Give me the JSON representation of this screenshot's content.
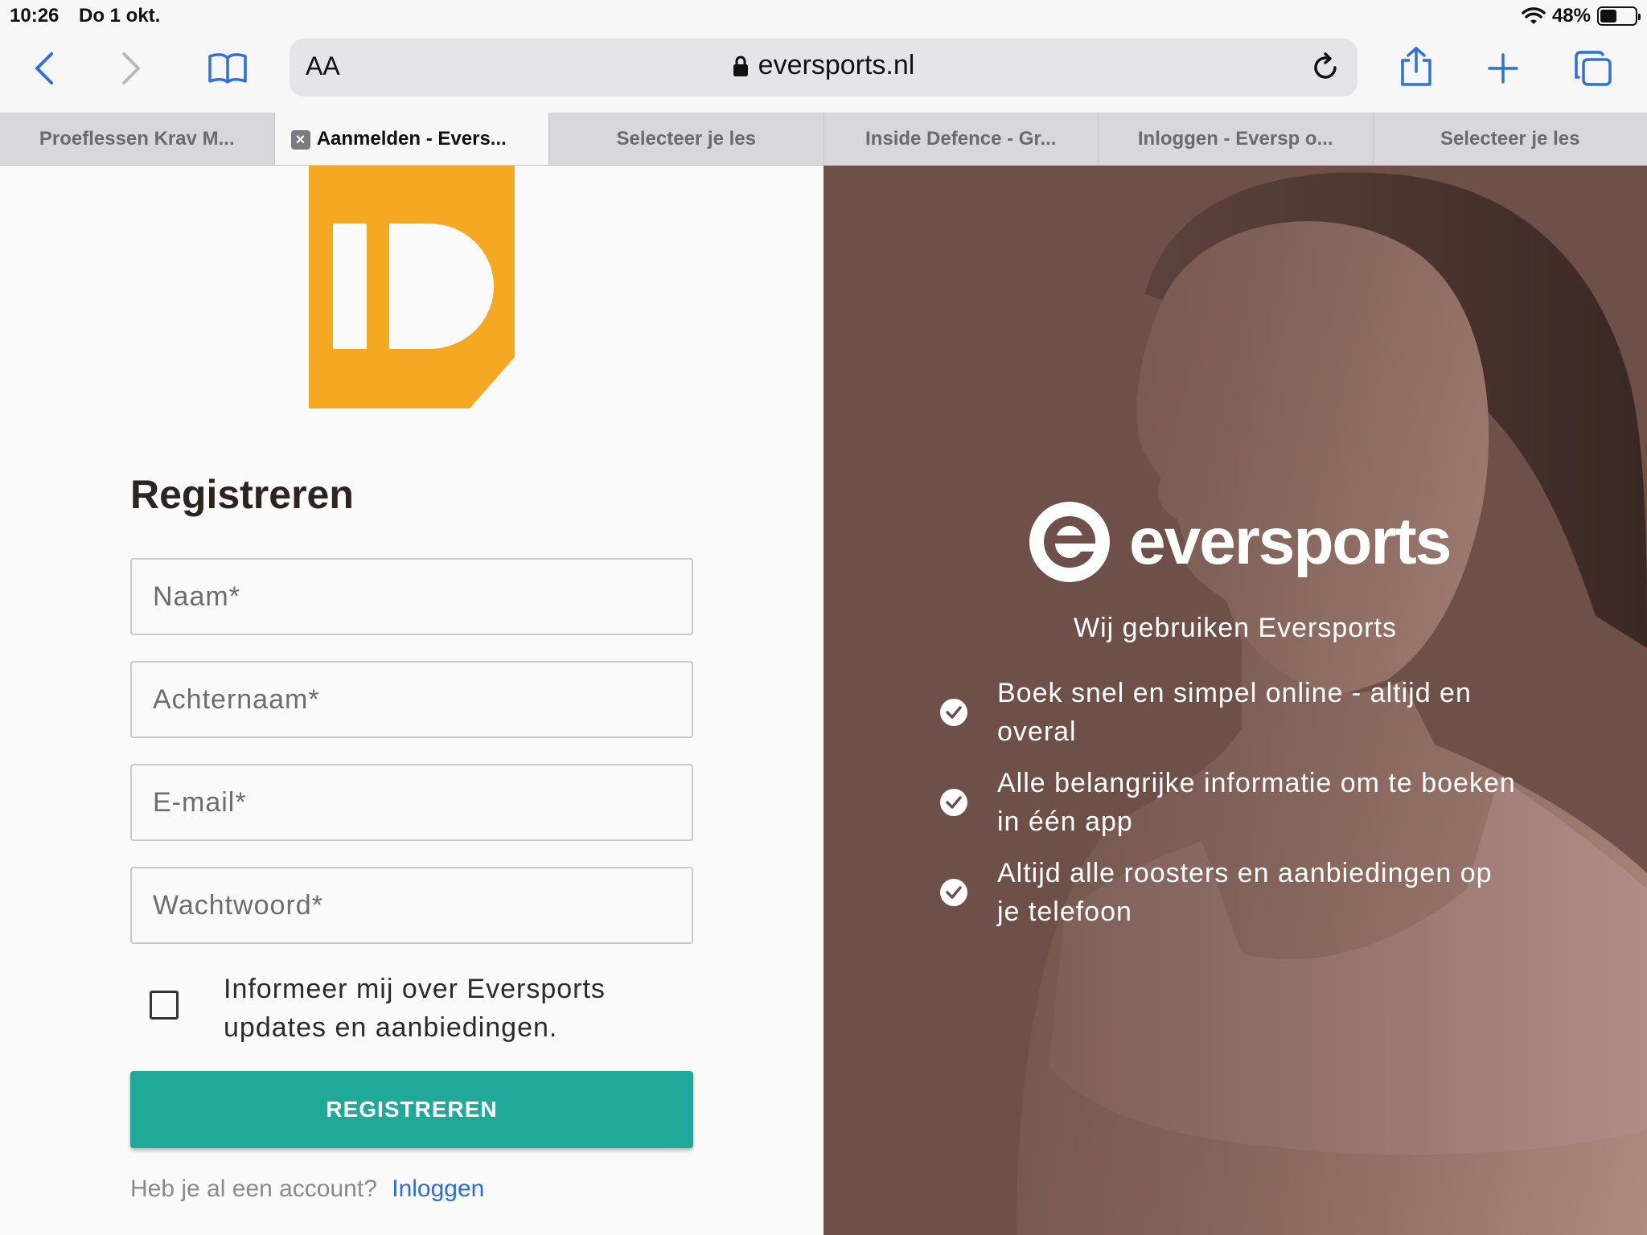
{
  "status": {
    "time": "10:26",
    "date": "Do 1 okt.",
    "battery": "48%",
    "battery_level": 0.48
  },
  "browser": {
    "text_size_label": "AA",
    "url": "eversports.nl",
    "tabs": [
      {
        "label": "Proeflessen Krav M..."
      },
      {
        "label": "Aanmelden - Evers..."
      },
      {
        "label": "Selecteer je les"
      },
      {
        "label": "Inside Defence - Gr..."
      },
      {
        "label": "Inloggen - Eversp o..."
      },
      {
        "label": "Selecteer je les"
      }
    ]
  },
  "form": {
    "title": "Registreren",
    "name_placeholder": "Naam*",
    "lastname_placeholder": "Achternaam*",
    "email_placeholder": "E-mail*",
    "password_placeholder": "Wachtwoord*",
    "consent_text": "Informeer mij over Eversports updates en aanbiedingen.",
    "submit_label": "REGISTREREN",
    "login_prompt": "Heb je al een account?",
    "login_link": "Inloggen"
  },
  "promo": {
    "brand": "eversports",
    "subtitle": "Wij gebruiken Eversports",
    "benefits": [
      {
        "text": "Boek snel en simpel online - altijd en overal"
      },
      {
        "text": "Alle belangrijke informatie om te boeken in één app"
      },
      {
        "text": "Altijd alle roosters en aanbiedingen op je telefoon"
      }
    ]
  },
  "colors": {
    "accent": "#20a898",
    "link": "#2a6fd6",
    "logo_orange": "#f5a821",
    "promo_bg": "#6e5048"
  }
}
